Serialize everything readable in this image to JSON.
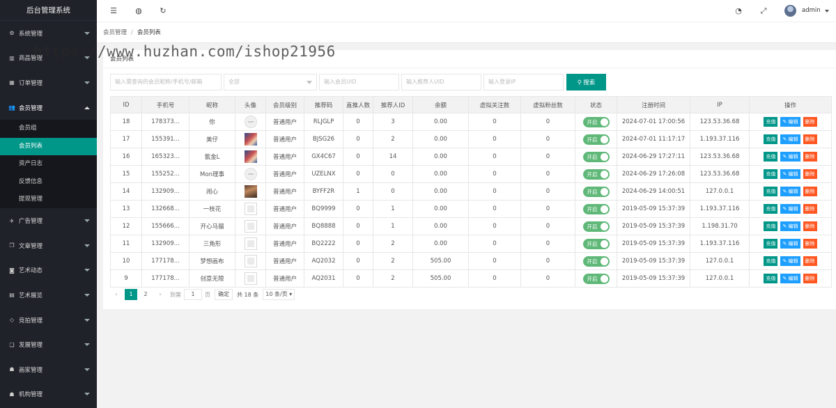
{
  "app": {
    "title": "后台管理系统",
    "user": "admin"
  },
  "sidebar": {
    "items": [
      {
        "icon": "gear-icon",
        "glyph": "⚙",
        "label": "系统管理",
        "open": false
      },
      {
        "icon": "bar-chart-icon",
        "glyph": "▥",
        "label": "商品管理",
        "open": false
      },
      {
        "icon": "calendar-icon",
        "glyph": "▦",
        "label": "订单管理",
        "open": false
      },
      {
        "icon": "users-icon",
        "glyph": "👥",
        "label": "会员管理",
        "open": true,
        "children": [
          {
            "label": "会员组",
            "active": false
          },
          {
            "label": "会员列表",
            "active": true
          },
          {
            "label": "资产日志",
            "active": false
          },
          {
            "label": "反馈信息",
            "active": false
          },
          {
            "label": "提现管理",
            "active": false
          }
        ]
      },
      {
        "icon": "rocket-icon",
        "glyph": "✈",
        "label": "广告管理",
        "open": false
      },
      {
        "icon": "copy-icon",
        "glyph": "❐",
        "label": "文章管理",
        "open": false
      },
      {
        "icon": "camera-icon",
        "glyph": "◙",
        "label": "艺术动态",
        "open": false
      },
      {
        "icon": "table-icon",
        "glyph": "▤",
        "label": "艺术展览",
        "open": false
      },
      {
        "icon": "tag-icon",
        "glyph": "◇",
        "label": "竞拍管理",
        "open": false
      },
      {
        "icon": "duplicate-icon",
        "glyph": "❏",
        "label": "发展管理",
        "open": false
      },
      {
        "icon": "person-icon",
        "glyph": "☗",
        "label": "画家管理",
        "open": false
      },
      {
        "icon": "org-icon",
        "glyph": "☗",
        "label": "机构管理",
        "open": false
      }
    ]
  },
  "header": {
    "icons": [
      "menu-fold-icon",
      "globe-icon",
      "refresh-icon",
      "theme-icon",
      "fullscreen-icon"
    ]
  },
  "breadcrumb": {
    "parent": "会员管理",
    "sep": "/",
    "current": "会员列表"
  },
  "watermark": "https://www.huzhan.com/ishop21956",
  "card": {
    "title": "会员列表"
  },
  "search": {
    "keyword_placeholder": "输入需查询的会员昵称/手机号/邮箱",
    "level_selected": "全部",
    "uid_placeholder": "输入会员UID",
    "ref_uid_placeholder": "输入推荐人UID",
    "ip_placeholder": "输入登录IP",
    "button": "搜索"
  },
  "table": {
    "headers": [
      "ID",
      "手机号",
      "昵称",
      "头像",
      "会员级别",
      "推荐码",
      "直推人数",
      "推荐人ID",
      "余额",
      "虚拟关注数",
      "虚拟粉丝数",
      "状态",
      "注册时间",
      "IP",
      "操作"
    ],
    "toggle_label": "开启",
    "actions": {
      "recharge": "充值",
      "edit": "✎ 编辑",
      "delete": "删除"
    },
    "rows": [
      {
        "id": "18",
        "phone": "178373...",
        "nick": "你",
        "avatar": "default",
        "level": "普通用户",
        "code": "RLJGLP",
        "direct": "0",
        "ref": "3",
        "balance": "0.00",
        "follow": "0",
        "fans": "0",
        "time": "2024-07-01 17:00:56",
        "ip": "123.53.36.68"
      },
      {
        "id": "17",
        "phone": "155391...",
        "nick": "美仔",
        "avatar": "photo1",
        "level": "普通用户",
        "code": "BJSG26",
        "direct": "0",
        "ref": "2",
        "balance": "0.00",
        "follow": "0",
        "fans": "0",
        "time": "2024-07-01 11:17:17",
        "ip": "1.193.37.116"
      },
      {
        "id": "16",
        "phone": "165323...",
        "nick": "氤金L",
        "avatar": "photo1",
        "level": "普通用户",
        "code": "GX4C67",
        "direct": "0",
        "ref": "14",
        "balance": "0.00",
        "follow": "0",
        "fans": "0",
        "time": "2024-06-29 17:27:11",
        "ip": "123.53.36.68"
      },
      {
        "id": "15",
        "phone": "155252...",
        "nick": "Mon理事",
        "avatar": "default",
        "level": "普通用户",
        "code": "UZELNX",
        "direct": "0",
        "ref": "0",
        "balance": "0.00",
        "follow": "0",
        "fans": "0",
        "time": "2024-06-29 17:26:08",
        "ip": "123.53.36.68"
      },
      {
        "id": "14",
        "phone": "132909...",
        "nick": "闹心",
        "avatar": "photo2",
        "level": "普通用户",
        "code": "BYFF2R",
        "direct": "1",
        "ref": "0",
        "balance": "0.00",
        "follow": "0",
        "fans": "0",
        "time": "2024-06-29 14:00:51",
        "ip": "127.0.0.1"
      },
      {
        "id": "13",
        "phone": "132668...",
        "nick": "一枝花",
        "avatar": "blank",
        "level": "普通用户",
        "code": "BQ9999",
        "direct": "0",
        "ref": "1",
        "balance": "0.00",
        "follow": "0",
        "fans": "0",
        "time": "2019-05-09 15:37:39",
        "ip": "1.193.37.116"
      },
      {
        "id": "12",
        "phone": "155666...",
        "nick": "开心马骝",
        "avatar": "blank",
        "level": "普通用户",
        "code": "BQ8888",
        "direct": "0",
        "ref": "1",
        "balance": "0.00",
        "follow": "0",
        "fans": "0",
        "time": "2019-05-09 15:37:39",
        "ip": "1.198.31.70"
      },
      {
        "id": "11",
        "phone": "132909...",
        "nick": "三角形",
        "avatar": "blank",
        "level": "普通用户",
        "code": "BQ2222",
        "direct": "0",
        "ref": "2",
        "balance": "0.00",
        "follow": "0",
        "fans": "0",
        "time": "2019-05-09 15:37:39",
        "ip": "1.193.37.116"
      },
      {
        "id": "10",
        "phone": "177178...",
        "nick": "梦想画布",
        "avatar": "blank",
        "level": "普通用户",
        "code": "AQ2032",
        "direct": "0",
        "ref": "2",
        "balance": "505.00",
        "follow": "0",
        "fans": "0",
        "time": "2019-05-09 15:37:39",
        "ip": "127.0.0.1"
      },
      {
        "id": "9",
        "phone": "177178...",
        "nick": "创意无限",
        "avatar": "blank",
        "level": "普通用户",
        "code": "AQ2031",
        "direct": "0",
        "ref": "2",
        "balance": "505.00",
        "follow": "0",
        "fans": "0",
        "time": "2019-05-09 15:37:39",
        "ip": "127.0.0.1"
      }
    ]
  },
  "pager": {
    "prev": "‹",
    "next": "›",
    "pages": [
      "1",
      "2"
    ],
    "current": "1",
    "goto_label": "到第",
    "goto_value": "1",
    "page_unit": "页",
    "confirm": "确定",
    "total": "共 18 条",
    "page_size": "10 条/页"
  }
}
